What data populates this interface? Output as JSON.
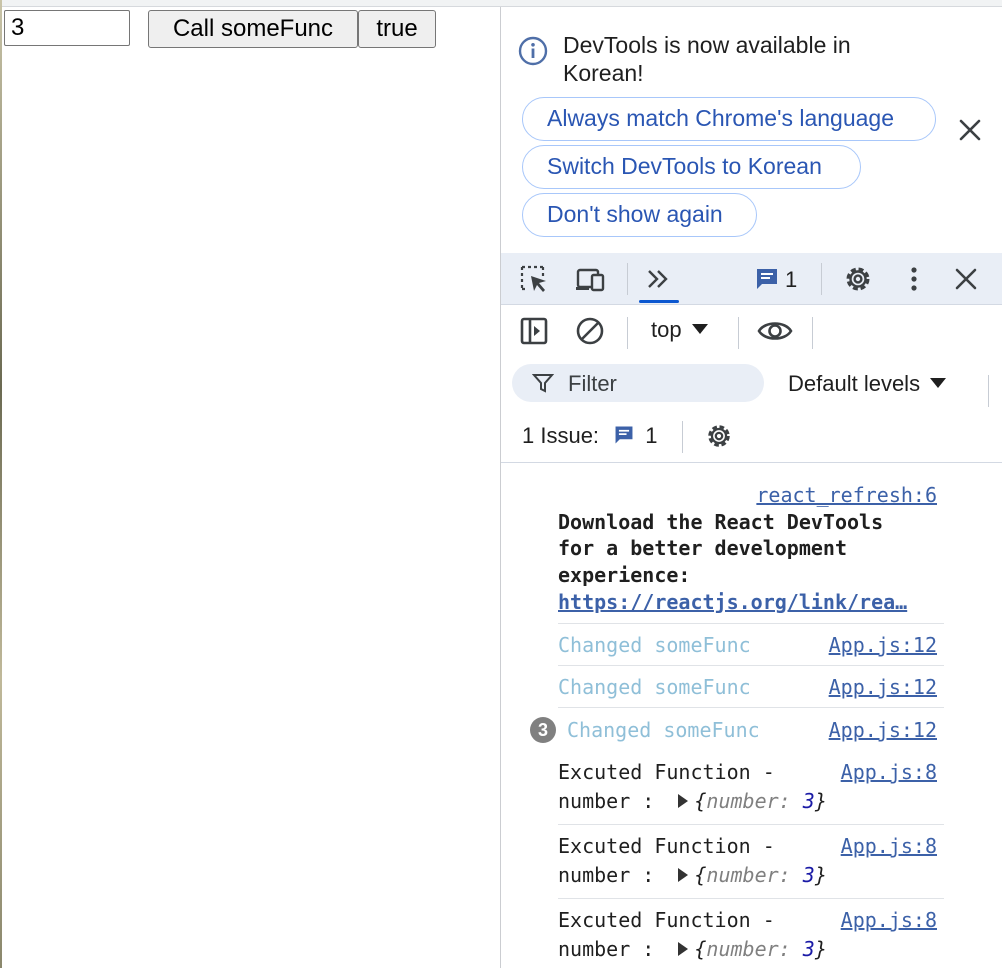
{
  "page": {
    "input_value": "3",
    "call_button_label": "Call someFunc",
    "toggle_button_label": "true"
  },
  "infobar": {
    "message": "DevTools is now available in Korean!",
    "options": [
      "Always match Chrome's language",
      "Switch DevTools to Korean",
      "Don't show again"
    ]
  },
  "main_toolbar": {
    "issue_count": "1"
  },
  "console_toolbar": {
    "context": "top",
    "filter_placeholder": "Filter",
    "levels": "Default levels",
    "issues_label": "1 Issue:",
    "issues_count": "1"
  },
  "console": {
    "react_source": "react_refresh:6",
    "react_msg_line1": "Download the React DevTools",
    "react_msg_line2": "for a better development",
    "react_msg_line3": "experience:",
    "react_link": "https://reactjs.org/link/rea…",
    "changed_text": "Changed someFunc",
    "changed_source": "App.js:12",
    "repeat_badge": "3",
    "exec_line1": "Excuted Function -",
    "exec_line2_prefix": "number :",
    "exec_source": "App.js:8",
    "obj_open": "{",
    "obj_key": "number",
    "obj_colon": ":",
    "obj_value": "3",
    "obj_close": "}"
  },
  "colors": {
    "accent": "#0b57d0",
    "pill_border": "#a8c7fa",
    "toolbar_bg": "#e9eef6",
    "link": "#3c61a8",
    "faded_log": "#8fbfd8"
  },
  "icons": [
    "info-icon",
    "close-icon",
    "inspect-element-icon",
    "device-toolbar-icon",
    "chevron-double-right-icon",
    "issues-message-icon",
    "gear-icon",
    "kebab-menu-icon",
    "sidebar-toggle-icon",
    "clear-console-icon",
    "eye-icon",
    "filter-icon"
  ]
}
